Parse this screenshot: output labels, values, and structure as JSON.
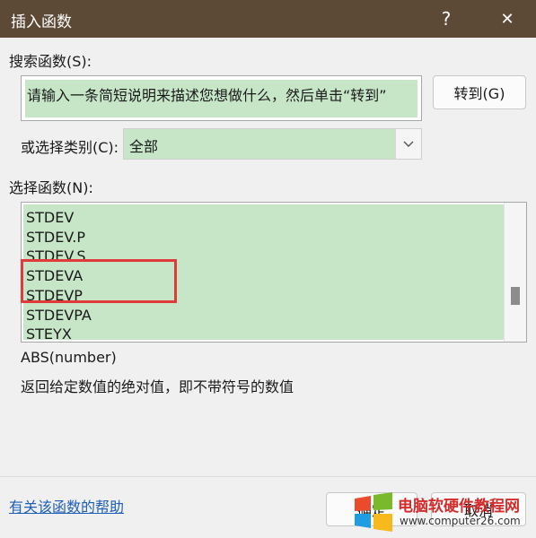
{
  "window": {
    "title": "插入函数",
    "help_glyph": "?",
    "close_glyph": "✕"
  },
  "search": {
    "label": "搜索函数(S):",
    "value": "请输入一条简短说明来描述您想做什么，然后单击“转到”",
    "go_button": "转到(G)"
  },
  "category": {
    "label": "或选择类别(C):",
    "selected": "全部"
  },
  "functions": {
    "label": "选择函数(N):",
    "items": [
      "STDEV",
      "STDEV.P",
      "STDEV.S",
      "STDEVA",
      "STDEVP",
      "STDEVPA",
      "STEYX"
    ],
    "highlighted": [
      "STDEVA",
      "STDEVP"
    ]
  },
  "description": {
    "signature": "ABS(number)",
    "text": "返回给定数值的绝对值，即不带符号的数值"
  },
  "footer": {
    "help_link": "有关该函数的帮助",
    "ok_button": "确定",
    "cancel_button": "取消"
  },
  "watermark": {
    "title": "电脑软硬件教程网",
    "url": "www.computer26.com"
  },
  "colors": {
    "titlebar": "#5c4a36",
    "field_bg": "#c7e6c8",
    "highlight_border": "#e03a3a",
    "link": "#1f5fb8"
  }
}
